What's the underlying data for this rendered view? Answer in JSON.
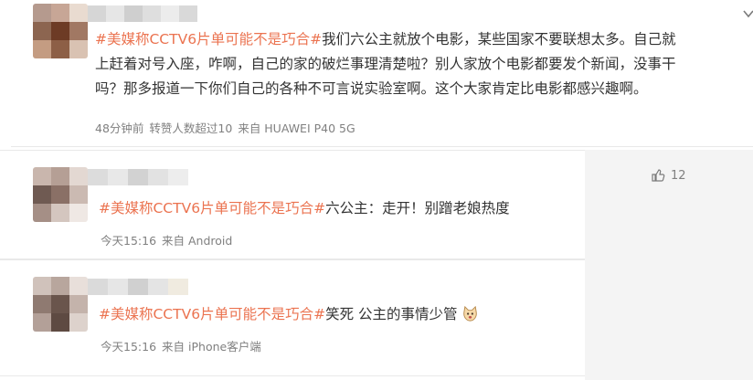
{
  "main_post": {
    "topic": "#美媒称CCTV6片单可能不是巧合#",
    "lines": [
      "我们六公主就放个电影，某些国家不要联想太多。自己就",
      "上赶着对号入座，咋啊，自己的家的破烂事理清楚啦？别人家放个电影都要发个新闻，没事干",
      "吗？那多报道一下你们自己的各种不可言说实验室啊。这个大家肯定比电影都感兴趣啊。"
    ],
    "time": "48分钟前",
    "reposts": "转赞人数超过10",
    "source": "来自 HUAWEI P40 5G",
    "menu_icon": "chevron-down-icon"
  },
  "reply1": {
    "topic": "#美媒称CCTV6片单可能不是巧合#",
    "text": "六公主：走开！别蹭老娘热度",
    "time": "今天15:16",
    "source": "来自 Android",
    "likes": "12",
    "like_icon": "thumbs-up-icon"
  },
  "reply2": {
    "topic": "#美媒称CCTV6片单可能不是巧合#",
    "text": "笑死 公主的事情少管",
    "emoji": "cat-face-emoji",
    "time": "今天15:16",
    "source": "来自 iPhone客户端"
  },
  "colors": {
    "topic": "#eb7350",
    "text": "#333333",
    "meta": "#808080",
    "background": "#ffffff",
    "divider": "#e9e9e9"
  }
}
